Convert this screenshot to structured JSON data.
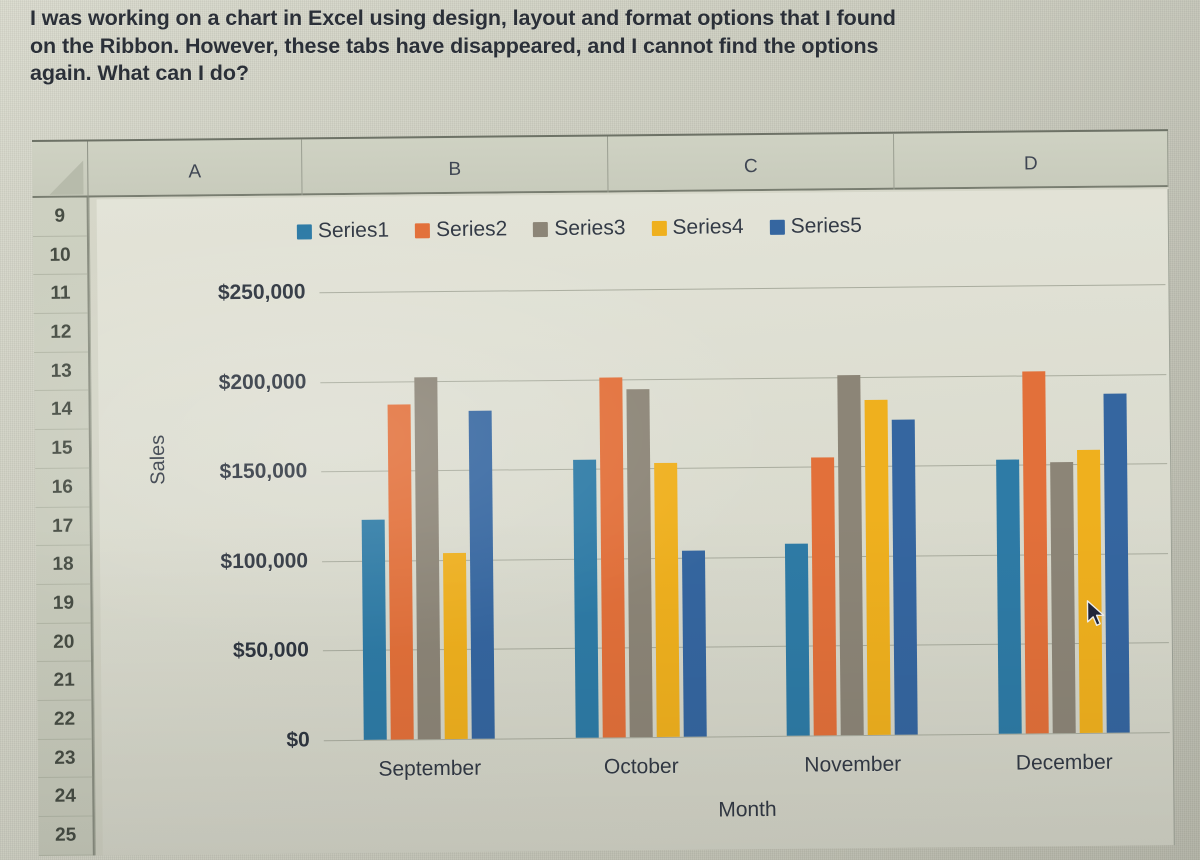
{
  "question": {
    "lines": [
      "I was working on a chart in Excel using design, layout and format options that I found",
      "on the Ribbon. However, these tabs have disappeared, and I cannot find the options",
      "again.  What can I do?"
    ]
  },
  "spreadsheet": {
    "columns": [
      "A",
      "B",
      "C",
      "D"
    ],
    "rows": [
      "9",
      "10",
      "11",
      "12",
      "13",
      "14",
      "15",
      "16",
      "17",
      "18",
      "19",
      "20",
      "21",
      "22",
      "23",
      "24",
      "25"
    ]
  },
  "cursor": {
    "icon": "mouse-pointer-icon"
  },
  "chart_data": {
    "type": "bar",
    "title": "",
    "xlabel": "Month",
    "ylabel": "Sales",
    "categories": [
      "September",
      "October",
      "November",
      "December"
    ],
    "ytick_labels": [
      "$250,000",
      "$200,000",
      "$150,000",
      "$100,000",
      "$50,000",
      "$0"
    ],
    "ytick_values": [
      250000,
      200000,
      150000,
      100000,
      50000,
      0
    ],
    "ylim": [
      0,
      250000
    ],
    "grid": true,
    "legend_position": "top",
    "colors": [
      "#2E7BA6",
      "#E2703A",
      "#8C8577",
      "#EFB01E",
      "#3566A0"
    ],
    "series": [
      {
        "name": "Series1",
        "color": "#2E7BA6",
        "values": [
          123000,
          155000,
          107000,
          153000
        ]
      },
      {
        "name": "Series2",
        "color": "#E2703A",
        "values": [
          187000,
          201000,
          155000,
          202000
        ]
      },
      {
        "name": "Series3",
        "color": "#8C8577",
        "values": [
          202000,
          194000,
          201000,
          151000
        ]
      },
      {
        "name": "Series4",
        "color": "#EFB01E",
        "values": [
          104000,
          153000,
          187000,
          158000
        ]
      },
      {
        "name": "Series5",
        "color": "#3566A0",
        "values": [
          183000,
          104000,
          176000,
          189000
        ]
      }
    ]
  }
}
